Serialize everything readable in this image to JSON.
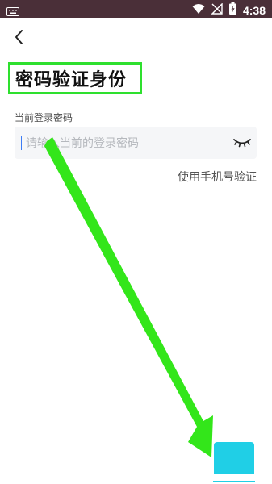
{
  "status_bar": {
    "time": "4:38",
    "icons": [
      "keyboard-icon",
      "wifi-icon",
      "no-signal-icon",
      "battery-icon"
    ]
  },
  "header": {
    "back_icon": "chevron-left-icon",
    "title": "密码验证身份"
  },
  "form": {
    "label": "当前登录密码",
    "password_placeholder": "请输入当前的登录密码",
    "eye_icon": "closed-eye-icon",
    "phone_verify_link": "使用手机号验证"
  },
  "colors": {
    "status_bar": "#4a2f38",
    "highlight_box": "#2ee02e",
    "arrow": "#33e61a",
    "button": "#20cfe6",
    "input_bg": "#f5f6f8"
  }
}
